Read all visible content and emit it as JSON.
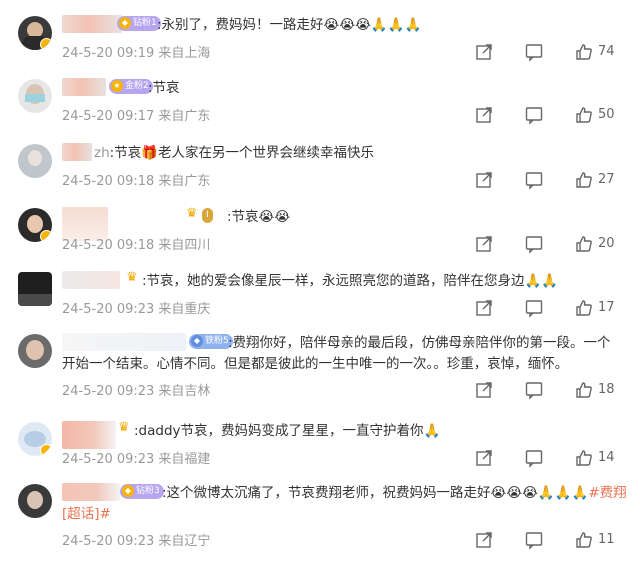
{
  "comments": [
    {
      "badge": "钻粉1",
      "text": ":永别了，费妈妈！一路走好😭😭😭🙏🙏🙏",
      "time": "24-5-20 09:19",
      "source": "来自上海",
      "likes": "74"
    },
    {
      "badge": "金粉2",
      "text": ":节哀",
      "time": "24-5-20 09:17",
      "source": "来自广东",
      "likes": "50"
    },
    {
      "name_suffix": "zh",
      "text": ":节哀🎁老人家在另一个世界会继续幸福快乐",
      "time": "24-5-20 09:18",
      "source": "来自广东",
      "likes": "27"
    },
    {
      "text": ":节哀😭😭",
      "time": "24-5-20 09:18",
      "source": "来自四川",
      "likes": "20"
    },
    {
      "text": ":节哀，她的爱会像星辰一样，永远照亮您的道路，陪伴在您身边🙏🙏",
      "time": "24-5-20 09:23",
      "source": "来自重庆",
      "likes": "17"
    },
    {
      "badge": "铁粉5",
      "text": ":费翔你好，陪伴母亲的最后段，仿佛母亲陪伴你的第一段。一个开始一个结束。心情不同。但是都是彼此的一生中唯一的一次。。珍重，哀悼，缅怀。",
      "time": "24-5-20 09:23",
      "source": "来自吉林",
      "likes": "18"
    },
    {
      "text": ":daddy节哀，费妈妈变成了星星，一直守护着你🙏",
      "time": "24-5-20 09:23",
      "source": "来自福建",
      "likes": "14"
    },
    {
      "badge": "钻粉3",
      "text": ":这个微博太沉痛了，节哀费翔老师，祝费妈妈一路走好😭😭😭🙏🙏🙏",
      "hashtag": "#费翔[超话]#",
      "time": "24-5-20 09:23",
      "source": "来自辽宁",
      "likes": "11"
    }
  ],
  "icons": {
    "share": "share-icon",
    "comment": "comment-icon",
    "like": "thumbs-up-icon"
  },
  "colors": {
    "meta_gray": "#999999",
    "hashtag": "#eb7350",
    "badge_purple": "#b8a5f0",
    "badge_blue": "#8fb3ef"
  }
}
